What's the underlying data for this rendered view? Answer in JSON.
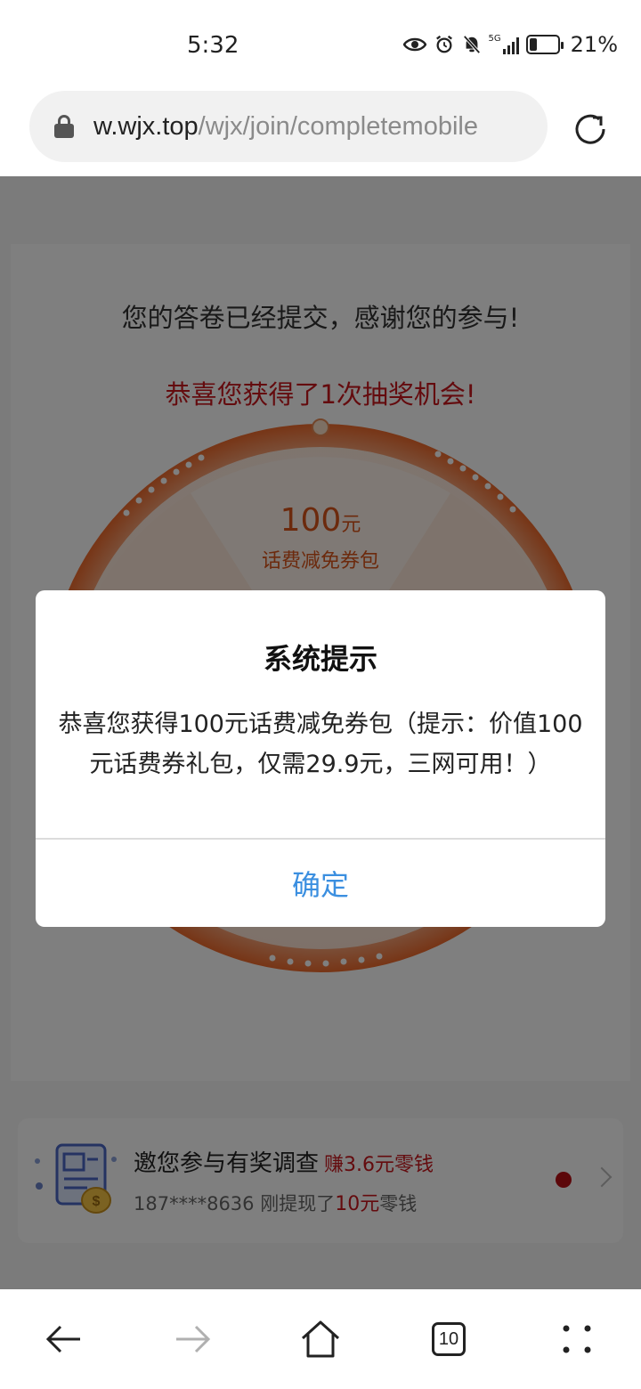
{
  "status_bar": {
    "time": "5:32",
    "signal_label": "5G",
    "battery": "21%"
  },
  "browser": {
    "url_host": "w.wjx.top",
    "url_path": "/wjx/join/completemobile"
  },
  "page": {
    "thanks_text": "您的答卷已经提交，感谢您的参与!",
    "congrats_text": "恭喜您获得了1次抽奖机会!",
    "wheel_prize": {
      "amount": "100",
      "unit": "元",
      "name": "话费减免券包"
    },
    "banner": {
      "title": "邀您参与有奖调查",
      "earn": "赚3.6元零钱",
      "sub_prefix": "187****8636 刚提现了",
      "sub_amount": "10元",
      "sub_suffix": "零钱"
    }
  },
  "dialog": {
    "title": "系统提示",
    "message": "恭喜您获得100元话费减免券包（提示：价值100元话费券礼包，仅需29.9元，三网可用！）",
    "ok_label": "确定"
  },
  "bottom_nav": {
    "tab_count": "10"
  },
  "colors": {
    "accent_red": "#c8161d",
    "link_blue": "#3b8fe0",
    "wheel_orange": "#f07a3a"
  }
}
